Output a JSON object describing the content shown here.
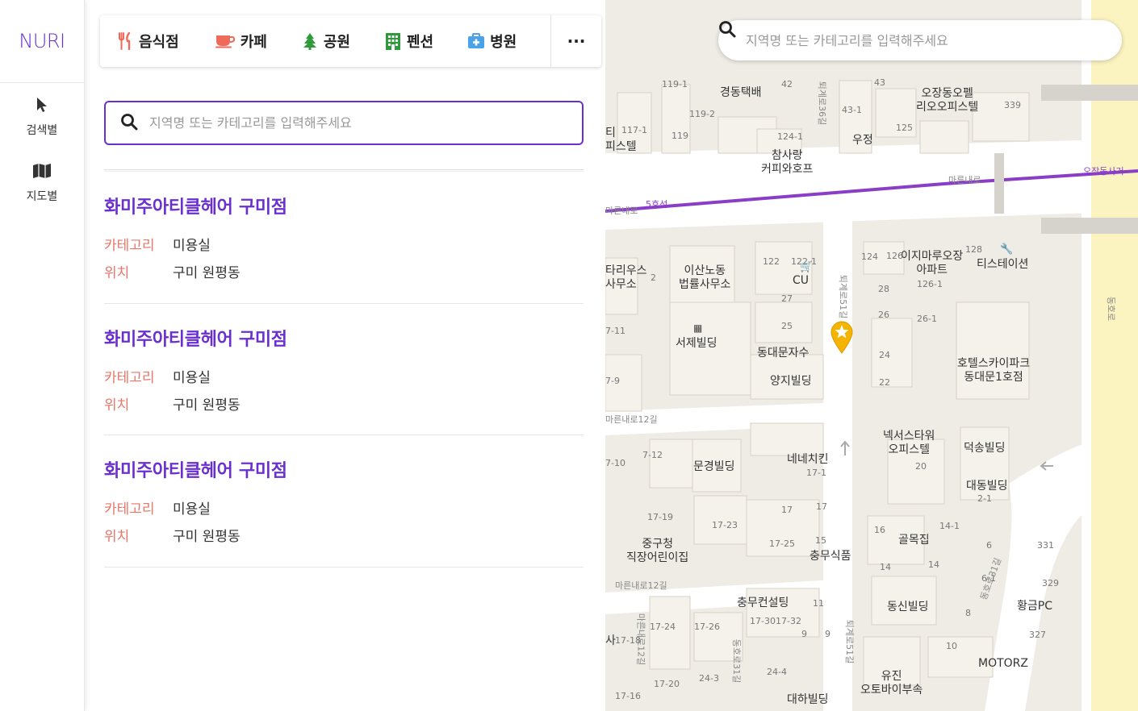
{
  "app": {
    "logo": "NURI"
  },
  "nav": [
    {
      "label": "검색별",
      "icon": "cursor-icon"
    },
    {
      "label": "지도별",
      "icon": "map-icon"
    }
  ],
  "categories": [
    {
      "label": "음식점",
      "icon": "utensils-icon",
      "color": "#f06a5a"
    },
    {
      "label": "카페",
      "icon": "coffee-cup-icon",
      "color": "#f06a5a"
    },
    {
      "label": "공원",
      "icon": "tree-icon",
      "color": "#2e9a3a"
    },
    {
      "label": "펜션",
      "icon": "building-icon",
      "color": "#2e9a3a"
    },
    {
      "label": "병원",
      "icon": "first-aid-icon",
      "color": "#4aa3e8"
    }
  ],
  "more_label": "···",
  "search": {
    "placeholder": "지역명 또는 카테고리를 입력해주세요"
  },
  "results": [
    {
      "title": "화미주아티클헤어 구미점",
      "category_key": "카테고리",
      "category": "미용실",
      "location_key": "위치",
      "location": "구미 원평동"
    },
    {
      "title": "화미주아티클헤어 구미점",
      "category_key": "카테고리",
      "category": "미용실",
      "location_key": "위치",
      "location": "구미 원평동"
    },
    {
      "title": "화미주아티클헤어 구미점",
      "category_key": "카테고리",
      "category": "미용실",
      "location_key": "위치",
      "location": "구미 원평동"
    }
  ],
  "map": {
    "search_placeholder": "지역명 또는 카테고리를 입력해주세요",
    "labels": {
      "l1": "경동택배",
      "l2": "오장동오펠\n리오오피스텔",
      "l3": "우정",
      "l4": "참사랑\n커피와호프",
      "l5": "이산노동\n법률사무소",
      "l6": "CU",
      "l7": "이지마루오장\n아파트",
      "l8": "티스테이션",
      "l9": "서제빌딩",
      "l10": "동대문자수",
      "l11": "양지빌딩",
      "l12": "호텔스카이파크\n동대문1호점",
      "l13": "넥서스타워\n오피스텔",
      "l14": "덕송빌딩",
      "l15": "네네치킨",
      "l16": "문경빌딩",
      "l17": "대동빌딩",
      "l18": "중구청\n직장어린이집",
      "l19": "충무식품",
      "l20": "골목집",
      "l21": "충무컨설팅",
      "l22": "동신빌딩",
      "l23": "황금PC",
      "l24": "MOTORZ",
      "l25": "유진\n오토바이부속",
      "l26": "대하빌딩",
      "l27": "타리우스\n사무소",
      "l28": "티\n피스텔",
      "l29": "사"
    },
    "subway_line": "5호선",
    "roads": {
      "r1": "마른내로",
      "r2": "오장동사거",
      "r3": "퇴계로51길",
      "r4": "마른내로12길",
      "r5": "마른내로12길",
      "r6": "퇴계로51길",
      "r7": "동호로31길",
      "r8": "마른내로12길",
      "r9": "동호로31길",
      "r10": "퇴계로36길",
      "r11": "마른내로",
      "r12": "동호로"
    },
    "numbers": {
      "n1": "119-1",
      "n2": "42",
      "n3": "43",
      "n4": "339",
      "n5": "117-1",
      "n6": "119-2",
      "n7": "119",
      "n8": "124-1",
      "n9": "43-1",
      "n10": "125",
      "n11": "122",
      "n12": "122-1",
      "n13": "124",
      "n14": "126",
      "n15": "128",
      "n16": "126-1",
      "n17": "27",
      "n18": "28",
      "n19": "25",
      "n20": "26",
      "n21": "26-1",
      "n22": "24",
      "n23": "22",
      "n24": "7-11",
      "n25": "7-9",
      "n26": "7-12",
      "n27": "7-10",
      "n28": "20",
      "n29": "17-1",
      "n30": "17-19",
      "n31": "17-23",
      "n32": "17",
      "n33": "17",
      "n34": "2-1",
      "n35": "17-25",
      "n36": "15",
      "n37": "16",
      "n38": "14-1",
      "n39": "14",
      "n40": "14",
      "n41": "6",
      "n42": "331",
      "n43": "329",
      "n44": "6-1",
      "n45": "11",
      "n46": "17-30",
      "n47": "17-32",
      "n48": "9",
      "n49": "9",
      "n50": "17-24",
      "n51": "17-26",
      "n52": "8",
      "n53": "327",
      "n54": "10",
      "n55": "24-4",
      "n56": "24-3",
      "n57": "17-20",
      "n58": "17-16",
      "n59": "17-18",
      "n60": "2"
    }
  }
}
